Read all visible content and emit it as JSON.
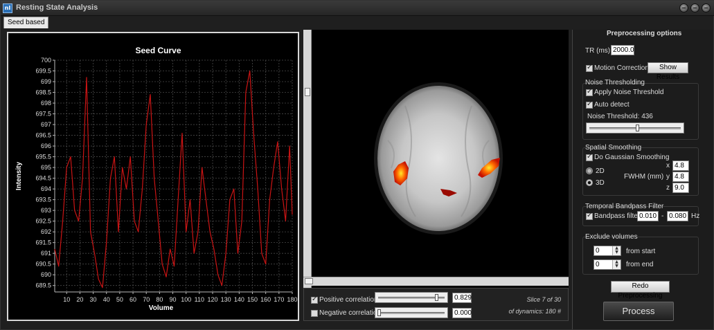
{
  "window": {
    "title": "Resting State Analysis",
    "icon_text": "nI"
  },
  "tabs": [
    {
      "label": "Seed based"
    }
  ],
  "chart_data": {
    "type": "line",
    "title": "Seed Curve",
    "xlabel": "Volume",
    "ylabel": "Intensity",
    "xlim": [
      1,
      180
    ],
    "ylim": [
      689.2,
      700
    ],
    "grid": true,
    "x_ticks": [
      10,
      20,
      30,
      40,
      50,
      60,
      70,
      80,
      90,
      100,
      110,
      120,
      130,
      140,
      150,
      160,
      170,
      180
    ],
    "y_ticks": [
      689.5,
      690,
      690.5,
      691,
      691.5,
      692,
      692.5,
      693,
      693.5,
      694,
      694.5,
      695,
      695.5,
      696,
      696.5,
      697,
      697.5,
      698,
      698.5,
      699,
      699.5,
      700
    ],
    "line_color": "#cc1414",
    "series": [
      {
        "x": [
          1,
          4,
          7,
          10,
          13,
          16,
          19,
          22,
          25,
          28,
          31,
          34,
          37,
          40,
          43,
          46,
          49,
          52,
          55,
          58,
          61,
          64,
          67,
          70,
          73,
          76,
          79,
          82,
          85,
          88,
          91,
          94,
          97,
          100,
          103,
          106,
          109,
          112,
          115,
          118,
          121,
          124,
          127,
          130,
          133,
          136,
          139,
          142,
          145,
          148,
          151,
          154,
          157,
          160,
          163,
          166,
          169,
          172,
          175,
          178,
          180
        ],
        "y": [
          691.2,
          690.4,
          692.5,
          695.0,
          695.5,
          693.0,
          692.5,
          694.5,
          699.2,
          692.0,
          691.0,
          689.8,
          689.4,
          691.5,
          694.5,
          695.5,
          692.0,
          695.0,
          694.0,
          695.5,
          692.5,
          692.0,
          694.0,
          697.0,
          698.4,
          694.5,
          692.5,
          690.5,
          689.9,
          691.2,
          690.4,
          693.5,
          696.6,
          692.0,
          693.5,
          691.0,
          692.0,
          695.0,
          693.5,
          692.0,
          691.2,
          690.0,
          689.5,
          691.0,
          693.5,
          694.0,
          691.0,
          692.5,
          698.5,
          699.5,
          696.5,
          694.0,
          691.0,
          690.5,
          693.5,
          695.0,
          696.2,
          694.0,
          692.5,
          696.0,
          692.8
        ]
      }
    ]
  },
  "correlation": {
    "positive": {
      "label": "Positive correlation",
      "checked": true,
      "value": "0.829",
      "fraction": 0.829
    },
    "negative": {
      "label": "Negative correlation",
      "checked": false,
      "value": "0.000",
      "fraction": 0.0
    },
    "slice_info": "Slice 7 of 30",
    "dynamics_info": "of dynamics: 180 #"
  },
  "preprocessing": {
    "header": "Preprocessing options",
    "tr_label": "TR (ms)",
    "tr_value": "2000.0",
    "motion_label": "Motion Correction",
    "show_results_label": "Show Results",
    "noise_title": "Noise Thresholding",
    "apply_noise_label": "Apply Noise Threshold",
    "auto_detect_label": "Auto detect",
    "noise_threshold_label": "Noise Threshold: 436",
    "noise_fraction": 0.55,
    "smoothing_title": "Spatial Smoothing",
    "gaussian_label": "Do Gaussian Smoothing",
    "mode_2d": "2D",
    "mode_3d": "3D",
    "fwhm_label": "FWHM (mm)",
    "x_label": "x",
    "x_value": "4.8",
    "y_label": "y",
    "y_value": "4.8",
    "z_label": "z",
    "z_value": "9.0",
    "bandpass_title": "Temporal Bandpass Filter",
    "bandpass_label": "Bandpass filter",
    "low_value": "0.010",
    "dash": "-",
    "high_value": "0.080",
    "hz_label": "Hz",
    "exclude_title": "Exclude volumes",
    "start_value": "0",
    "start_label": "from start",
    "end_value": "0",
    "end_label": "from end",
    "redo_label": "Redo Preprocessing",
    "process_label": "Process"
  }
}
